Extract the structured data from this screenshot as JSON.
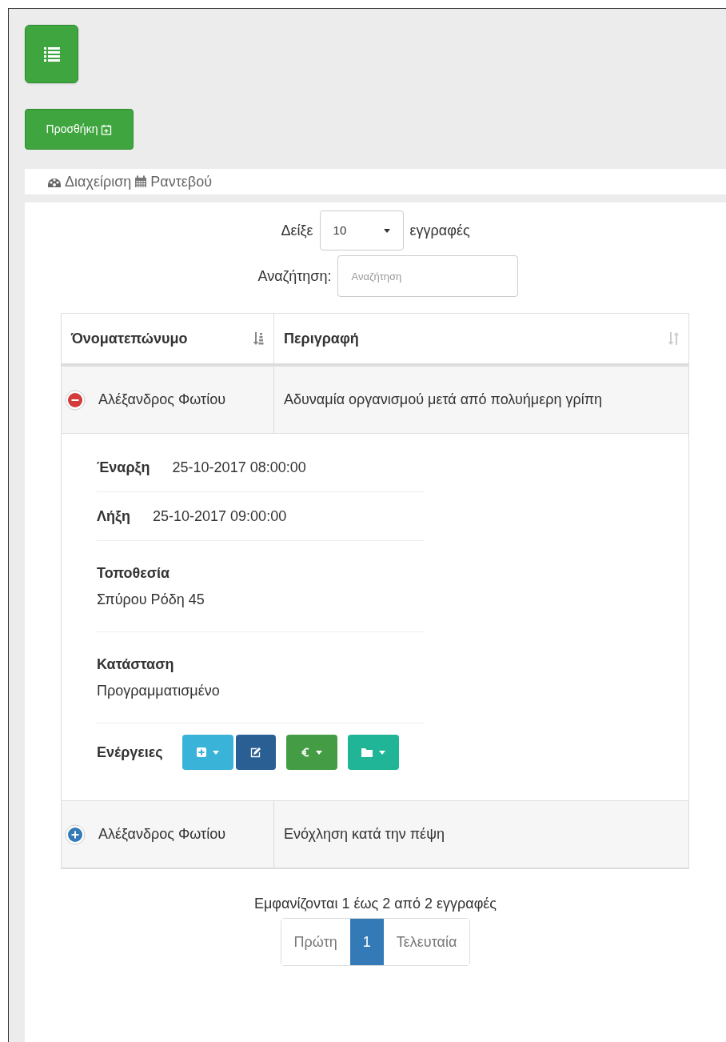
{
  "add_button": {
    "label": "Προσθήκη"
  },
  "breadcrumb": [
    {
      "kind": "dashboard",
      "label": "Διαχείριση"
    },
    {
      "kind": "calendar",
      "label": "Ραντεβού"
    }
  ],
  "length": {
    "prefix": "Δείξε",
    "value": "10",
    "suffix": "εγγραφές"
  },
  "search": {
    "label": "Αναζήτηση:",
    "placeholder": "Αναζήτηση"
  },
  "table": {
    "columns": [
      {
        "label": "Όνοματεπώνυμο",
        "sorted": true
      },
      {
        "label": "Περιγραφή",
        "sorted": false
      }
    ],
    "rows": [
      {
        "expanded": true,
        "name": "Αλέξανδρος Φωτίου",
        "description": "Αδυναμία οργανισμού μετά από πολυήμερη γρίπη",
        "details": [
          {
            "kind": "inline",
            "label": "Έναρξη",
            "value": "25-10-2017 08:00:00"
          },
          {
            "kind": "inline",
            "label": "Λήξη",
            "value": "25-10-2017 09:00:00"
          },
          {
            "kind": "stacked",
            "label": "Τοποθεσία",
            "value": "Σπύρου Ρόδη 45"
          },
          {
            "kind": "stacked",
            "label": "Κατάσταση",
            "value": "Προγραμματισμένο"
          }
        ],
        "actions_label": "Ενέργειες",
        "actions": [
          {
            "kind": "add",
            "caret": true
          },
          {
            "kind": "edit",
            "caret": false
          },
          {
            "kind": "euro",
            "caret": true
          },
          {
            "kind": "folder",
            "caret": true
          }
        ]
      },
      {
        "expanded": false,
        "name": "Αλέξανδρος Φωτίου",
        "description": "Ενόχληση κατά την πέψη"
      }
    ]
  },
  "info": "Εμφανίζονται 1 έως 2 από 2 εγγραφές",
  "pagination": [
    {
      "label": "Πρώτη",
      "selected": false
    },
    {
      "label": "1",
      "selected": true
    },
    {
      "label": "Τελευταία",
      "selected": false
    }
  ]
}
